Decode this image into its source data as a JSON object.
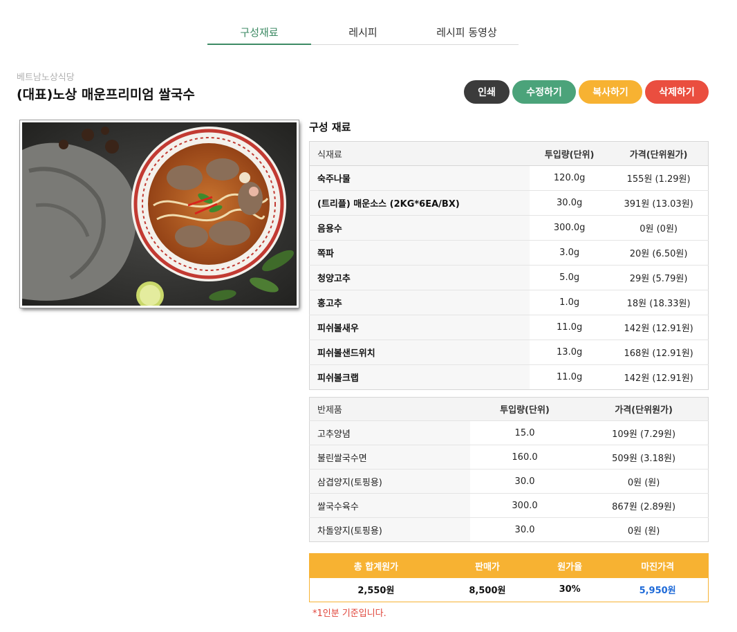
{
  "tabs": [
    {
      "label": "구성재료",
      "active": true
    },
    {
      "label": "레시피",
      "active": false
    },
    {
      "label": "레시피 동영상",
      "active": false
    }
  ],
  "header": {
    "store": "베트남노상식당",
    "title": "(대표)노상 매운프리미엄 쌀국수"
  },
  "actions": {
    "print": "인쇄",
    "edit": "수정하기",
    "copy": "복사하기",
    "delete": "삭제하기"
  },
  "section": {
    "title": "구성 재료"
  },
  "ingredients": {
    "headers": {
      "name": "식재료",
      "amount": "투입량(단위)",
      "price": "가격(단위원가)"
    },
    "rows": [
      {
        "name": "숙주나물",
        "amount": "120.0g",
        "price": "155원 (1.29원)"
      },
      {
        "name": "(트리플) 매운소스 (2KG*6EA/BX)",
        "amount": "30.0g",
        "price": "391원 (13.03원)"
      },
      {
        "name": "음용수",
        "amount": "300.0g",
        "price": "0원 (0원)"
      },
      {
        "name": "쪽파",
        "amount": "3.0g",
        "price": "20원 (6.50원)"
      },
      {
        "name": "청양고추",
        "amount": "5.0g",
        "price": "29원 (5.79원)"
      },
      {
        "name": "홍고추",
        "amount": "1.0g",
        "price": "18원 (18.33원)"
      },
      {
        "name": "피쉬볼새우",
        "amount": "11.0g",
        "price": "142원 (12.91원)"
      },
      {
        "name": "피쉬볼샌드위치",
        "amount": "13.0g",
        "price": "168원 (12.91원)"
      },
      {
        "name": "피쉬볼크랩",
        "amount": "11.0g",
        "price": "142원 (12.91원)"
      }
    ]
  },
  "semi_products": {
    "headers": {
      "name": "반제품",
      "amount": "투입량(단위)",
      "price": "가격(단위원가)"
    },
    "rows": [
      {
        "name": "고추양념",
        "amount": "15.0",
        "price": "109원 (7.29원)"
      },
      {
        "name": "불린쌀국수면",
        "amount": "160.0",
        "price": "509원 (3.18원)"
      },
      {
        "name": "삼겹양지(토핑용)",
        "amount": "30.0",
        "price": "0원 (원)"
      },
      {
        "name": "쌀국수육수",
        "amount": "300.0",
        "price": "867원 (2.89원)"
      },
      {
        "name": "차돌양지(토핑용)",
        "amount": "30.0",
        "price": "0원 (원)"
      }
    ]
  },
  "summary": {
    "headers": {
      "total": "총 합계원가",
      "sale": "판매가",
      "ratio": "원가율",
      "margin": "마진가격"
    },
    "values": {
      "total": "2,550원",
      "sale": "8,500원",
      "ratio": "30%",
      "margin": "5,950원"
    }
  },
  "note": "*1인분 기준입니다.",
  "colors": {
    "accent_green": "#3d8a64",
    "edit": "#4ba37a",
    "copy": "#f7b232",
    "delete": "#ea4e3f",
    "print": "#3b3b3b",
    "margin_text": "#1e6ad8",
    "note": "#e0443a"
  },
  "image": {
    "alt": "dish-photo"
  }
}
